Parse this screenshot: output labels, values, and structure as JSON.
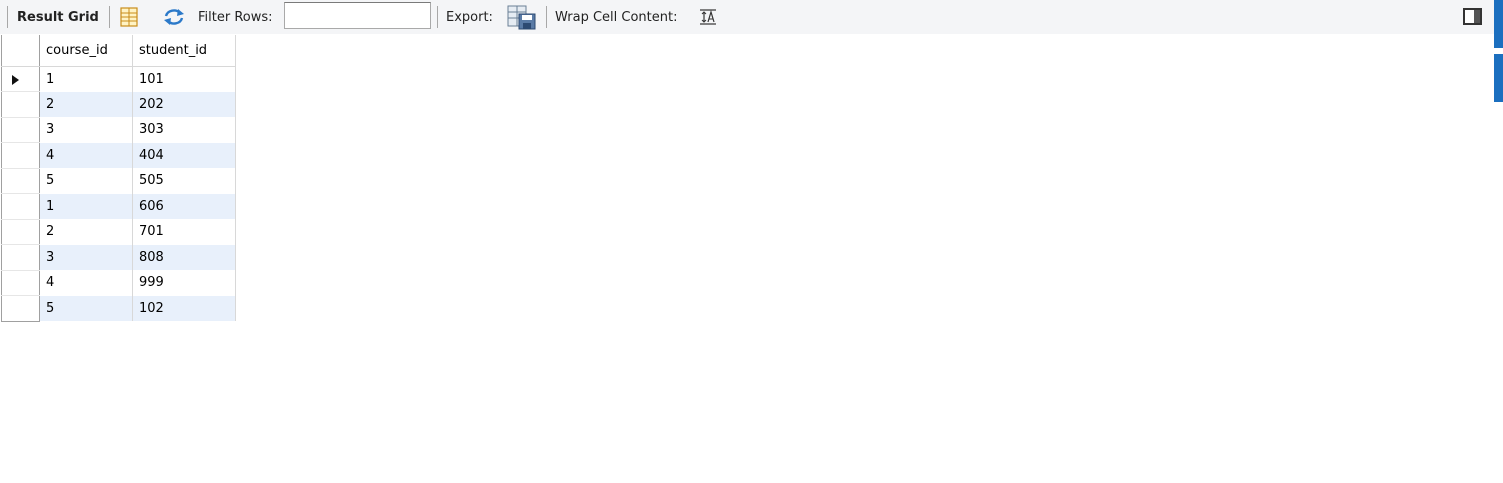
{
  "toolbar": {
    "result_grid_label": "Result Grid",
    "filter_rows_label": "Filter Rows:",
    "filter_value": "",
    "export_label": "Export:",
    "wrap_label": "Wrap Cell Content:",
    "icons": [
      "grid-form-icon",
      "refresh-icon",
      "export-icon",
      "wrap-text-icon",
      "panel-toggle-icon"
    ]
  },
  "grid": {
    "columns": [
      "course_id",
      "student_id"
    ],
    "rows": [
      {
        "course_id": "1",
        "student_id": "101"
      },
      {
        "course_id": "2",
        "student_id": "202"
      },
      {
        "course_id": "3",
        "student_id": "303"
      },
      {
        "course_id": "4",
        "student_id": "404"
      },
      {
        "course_id": "5",
        "student_id": "505"
      },
      {
        "course_id": "1",
        "student_id": "606"
      },
      {
        "course_id": "2",
        "student_id": "701"
      },
      {
        "course_id": "3",
        "student_id": "808"
      },
      {
        "course_id": "4",
        "student_id": "999"
      },
      {
        "course_id": "5",
        "student_id": "102"
      }
    ],
    "current_row": 0
  },
  "colors": {
    "toolbar_bg": "#f4f5f7",
    "alt_row": "#e8f0fb",
    "accent": "#1b6fbf"
  }
}
